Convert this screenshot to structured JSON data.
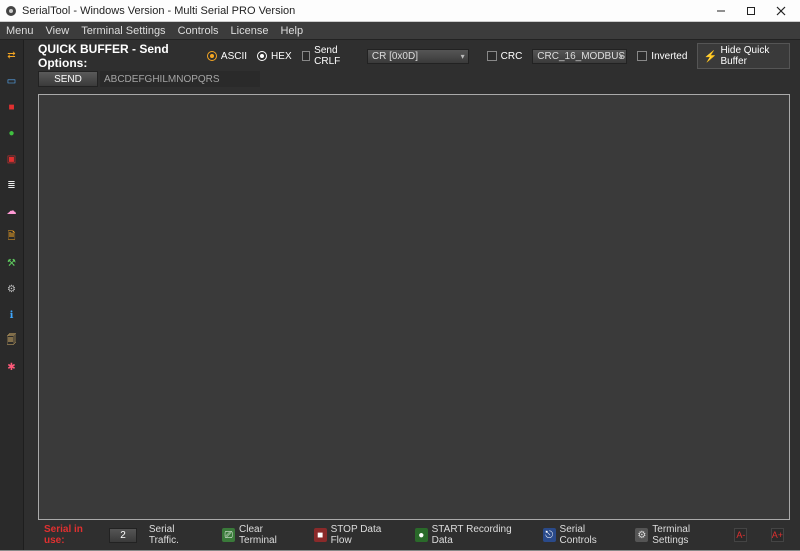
{
  "title": "SerialTool  - Windows Version  - Multi Serial PRO Version",
  "menu": [
    "Menu",
    "View",
    "Terminal Settings",
    "Controls",
    "License",
    "Help"
  ],
  "sidebar": {
    "items": [
      {
        "name": "sb-connect-icon",
        "color": "#f5a623",
        "glyph": "⇄"
      },
      {
        "name": "sb-terminal-icon",
        "color": "#5ab0ff",
        "glyph": "▭"
      },
      {
        "name": "sb-record-icon",
        "color": "#e03030",
        "glyph": "■"
      },
      {
        "name": "sb-play-icon",
        "color": "#40c040",
        "glyph": "●"
      },
      {
        "name": "sb-stop-icon",
        "color": "#e03030",
        "glyph": "▣"
      },
      {
        "name": "sb-layers-icon",
        "color": "#eeeeee",
        "glyph": "≣"
      },
      {
        "name": "sb-chat-icon",
        "color": "#ff9ad5",
        "glyph": "☁"
      },
      {
        "name": "sb-script-icon",
        "color": "#f5a623",
        "glyph": "🗎"
      },
      {
        "name": "sb-tools-icon",
        "color": "#60d060",
        "glyph": "⚒"
      },
      {
        "name": "sb-settings-icon",
        "color": "#bbbbbb",
        "glyph": "⚙"
      },
      {
        "name": "sb-info-icon",
        "color": "#3fa8ff",
        "glyph": "ℹ"
      },
      {
        "name": "sb-doc-icon",
        "color": "#d8b26a",
        "glyph": "🗐"
      },
      {
        "name": "sb-globe-icon",
        "color": "#ff5a7a",
        "glyph": "✱"
      }
    ]
  },
  "quickbuffer": {
    "heading": "QUICK BUFFER - Send Options:",
    "ascii_label": "ASCII",
    "hex_label": "HEX",
    "send_crlf_label": "Send CRLF",
    "eol_value": "CR [0x0D]",
    "crc_label": "CRC",
    "crc_value": "CRC_16_MODBUS",
    "inverted_label": "Inverted",
    "hide_label": "Hide Quick Buffer",
    "send_label": "SEND",
    "buffer_text": "ABCDEFGHILMNOPQRS"
  },
  "statusbar": {
    "serial_in_use": "Serial in use:",
    "port_value": "2",
    "traffic_label": "Serial Traffic.",
    "clear_terminal": "Clear Terminal",
    "stop_flow": "STOP Data Flow",
    "start_record": "START Recording Data",
    "serial_controls": "Serial Controls",
    "terminal_settings": "Terminal Settings",
    "font_dec": "A-",
    "font_inc": "A+"
  }
}
